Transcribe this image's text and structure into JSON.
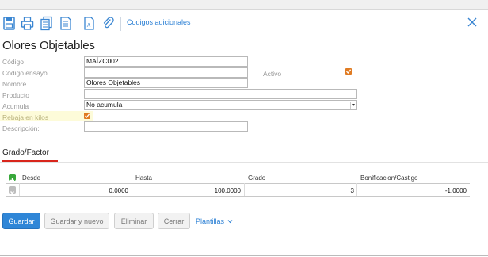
{
  "toolbar": {
    "icons": [
      "save-icon",
      "print-icon",
      "copy-document-icon",
      "document-list-icon",
      "pdf-file-icon",
      "attachment-icon"
    ],
    "link_label": "Codigos adicionales"
  },
  "page": {
    "title": "Olores Objetables"
  },
  "form": {
    "codigo_label": "Código",
    "codigo_value": "MAÍZC002",
    "codigo_ensayo_label": "Código ensayo",
    "codigo_ensayo_value": "",
    "activo_label": "Activo",
    "activo_checked": true,
    "nombre_label": "Nombre",
    "nombre_value": "Olores Objetables",
    "producto_label": "Producto",
    "producto_value": "",
    "acumula_label": "Acumula",
    "acumula_value": "No acumula",
    "rebaja_label": "Rebaja en kilos",
    "rebaja_checked": true,
    "descripcion_label": "Descripción:",
    "descripcion_value": ""
  },
  "tabs": [
    {
      "label": "Grado/Factor",
      "active": true
    }
  ],
  "grid": {
    "headers": [
      "Desde",
      "Hasta",
      "Grado",
      "Bonificacion/Castigo"
    ],
    "rows": [
      {
        "desde": "0.0000",
        "hasta": "100.0000",
        "grado": "3",
        "bonificacion": "-1.0000"
      }
    ]
  },
  "buttons": {
    "guardar": "Guardar",
    "guardar_nuevo": "Guardar y nuevo",
    "eliminar": "Eliminar",
    "cerrar": "Cerrar",
    "plantillas": "Plantillas"
  },
  "colors": {
    "accent": "#2f86d7",
    "link": "#2a7fd4",
    "checkbox": "#e07b22",
    "tab_underline": "#d9261c"
  }
}
